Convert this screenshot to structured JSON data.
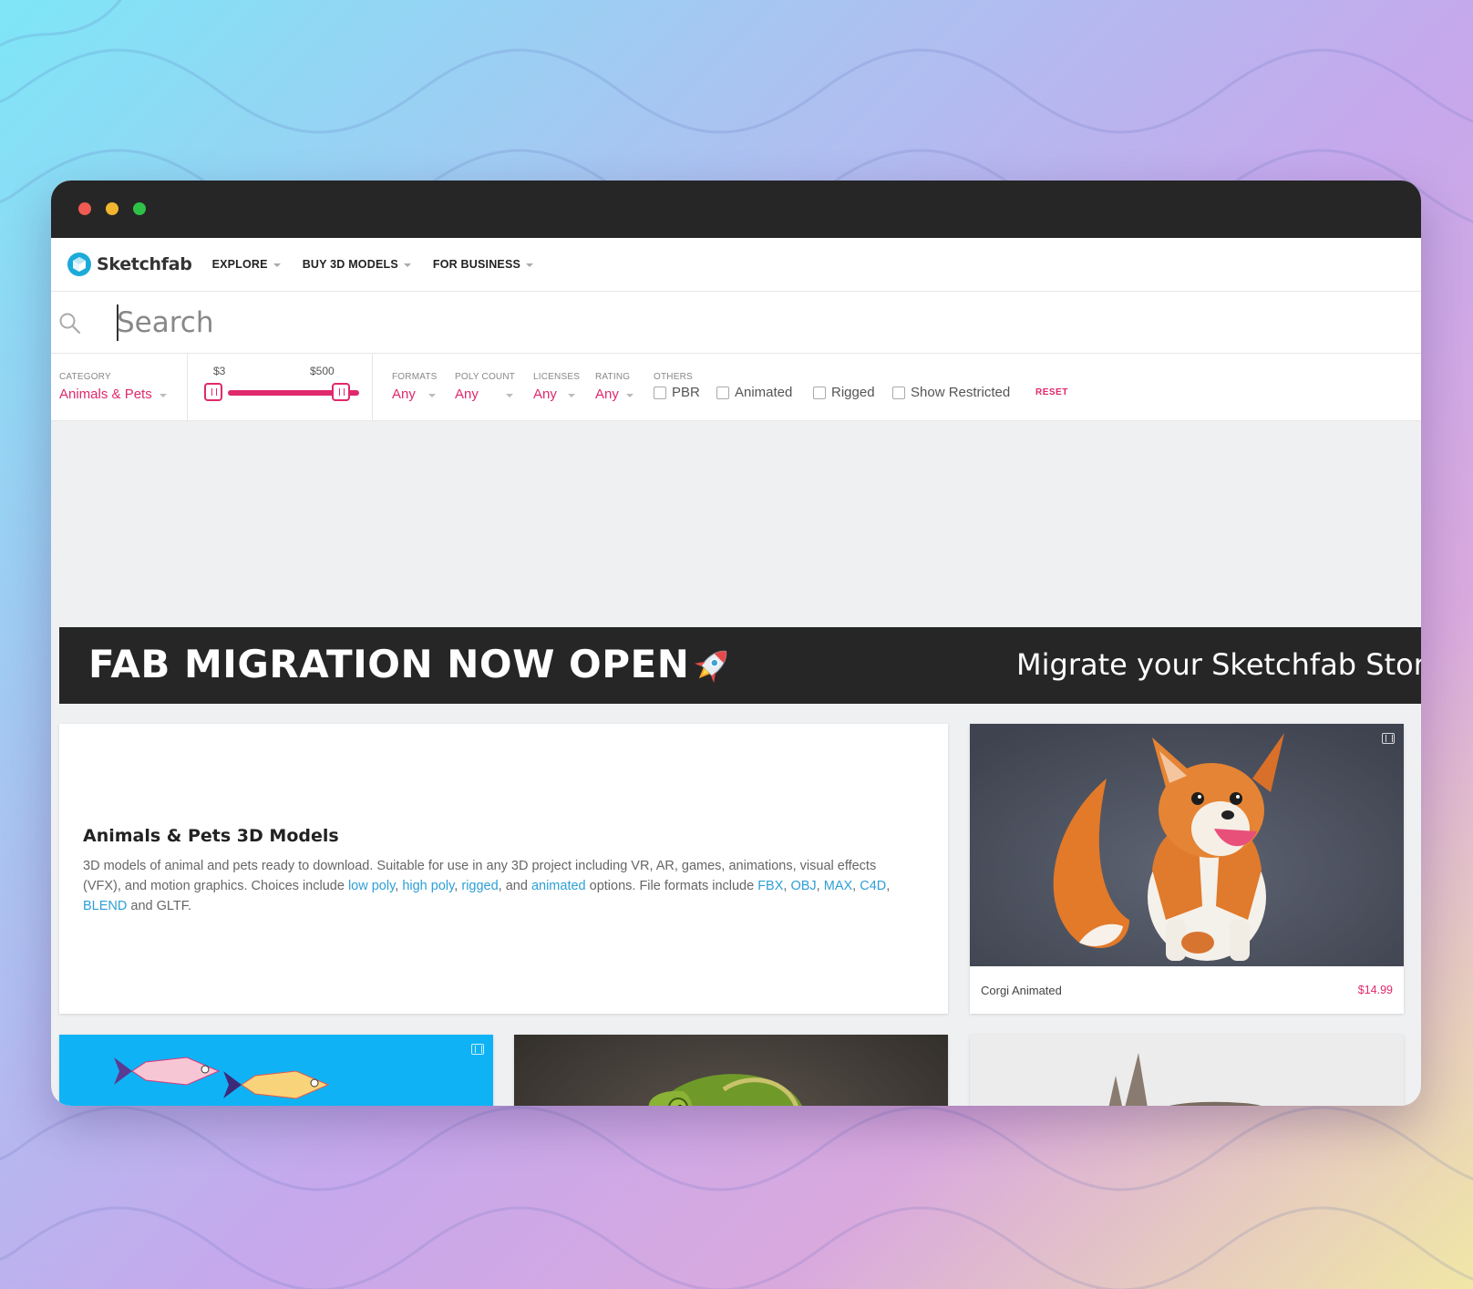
{
  "nav": {
    "logo_text": "Sketchfab",
    "items": [
      {
        "label": "EXPLORE"
      },
      {
        "label": "BUY 3D MODELS"
      },
      {
        "label": "FOR BUSINESS"
      }
    ]
  },
  "search": {
    "placeholder": "Search",
    "value": ""
  },
  "filters": {
    "category": {
      "label": "CATEGORY",
      "value": "Animals & Pets"
    },
    "price": {
      "min_label": "$3",
      "max_label": "$500",
      "min": 3,
      "max": 500
    },
    "formats": {
      "label": "FORMATS",
      "value": "Any"
    },
    "poly_count": {
      "label": "POLY COUNT",
      "value": "Any"
    },
    "licenses": {
      "label": "LICENSES",
      "value": "Any"
    },
    "rating": {
      "label": "RATING",
      "value": "Any"
    },
    "others": {
      "label": "OTHERS"
    },
    "checkboxes": {
      "pbr": "PBR",
      "animated": "Animated",
      "rigged": "Rigged",
      "show_restricted": "Show Restricted"
    },
    "reset": "RESET"
  },
  "banner": {
    "title": "FAB MIGRATION NOW OPEN",
    "subtitle": "Migrate your Sketchfab Store Ass"
  },
  "intro": {
    "title": "Animals & Pets 3D Models",
    "text_parts": {
      "p1": "3D models of animal and pets ready to download. Suitable for use in any 3D project including VR, AR, games, animations, visual effects (VFX), and motion graphics. Choices include ",
      "low_poly": "low poly",
      "sep1": ", ",
      "high_poly": "high poly",
      "sep2": ", ",
      "rigged": "rigged",
      "sep3": ", and ",
      "animated": "animated",
      "p2": " options. File formats include ",
      "fbx": "FBX",
      "sep4": ", ",
      "obj": "OBJ",
      "sep5": ", ",
      "max": "MAX",
      "sep6": ", ",
      "c4d": "C4D",
      "sep7": ", ",
      "blend": "BLEND",
      "p3": " and GLTF."
    }
  },
  "models": [
    {
      "name": "Corgi Animated",
      "price": "$14.99"
    }
  ],
  "colors": {
    "accent": "#e0286c",
    "link": "#2e9fd6",
    "dark": "#262626"
  }
}
